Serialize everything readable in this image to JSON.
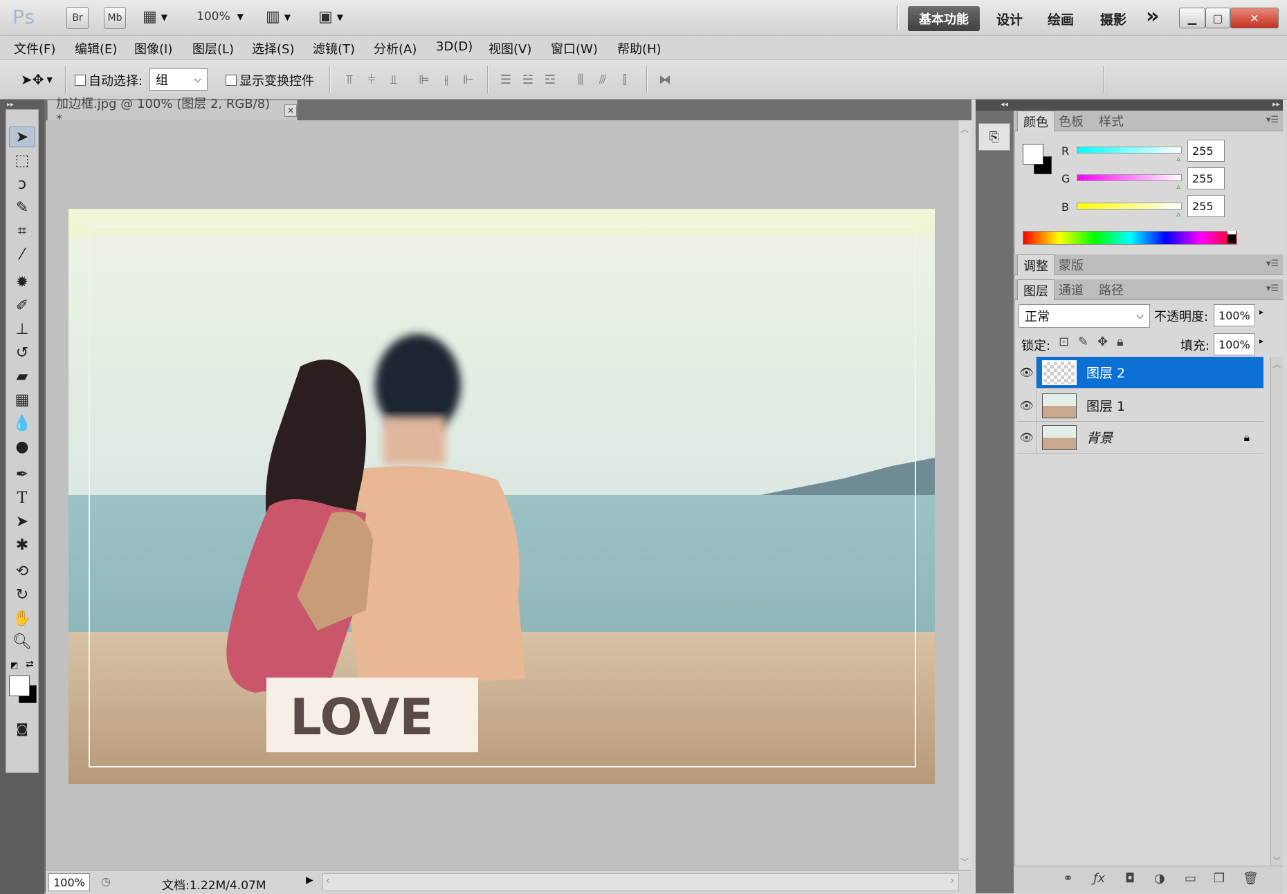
{
  "app": {
    "logo": "Ps",
    "bridge_badge": "Br",
    "minibridge_badge": "Mb",
    "zoom_level": "100%",
    "workspaces": [
      "基本功能",
      "设计",
      "绘画",
      "摄影"
    ],
    "more_workspaces": "»"
  },
  "menu": [
    "文件(F)",
    "编辑(E)",
    "图像(I)",
    "图层(L)",
    "选择(S)",
    "滤镜(T)",
    "分析(A)",
    "3D(D)",
    "视图(V)",
    "窗口(W)",
    "帮助(H)"
  ],
  "options": {
    "auto_select_label": "自动选择:",
    "auto_select_value": "组",
    "show_transform_label": "显示变换控件"
  },
  "document": {
    "tab_title": "加边框.jpg @ 100% (图层 2, RGB/8) *",
    "status_zoom": "100%",
    "status_doc": "文档:1.22M/4.07M",
    "image_text": "LOVE"
  },
  "color_panel": {
    "tabs": [
      "颜色",
      "色板",
      "样式"
    ],
    "r_label": "R",
    "g_label": "G",
    "b_label": "B",
    "r": "255",
    "g": "255",
    "b": "255"
  },
  "adjust_panel": {
    "tabs": [
      "调整",
      "蒙版"
    ]
  },
  "layers_panel": {
    "tabs": [
      "图层",
      "通道",
      "路径"
    ],
    "blend_mode": "正常",
    "opacity_label": "不透明度:",
    "opacity": "100%",
    "lock_label": "锁定:",
    "fill_label": "填充:",
    "fill": "100%",
    "layers": [
      {
        "name": "图层 2",
        "selected": true
      },
      {
        "name": "图层 1",
        "selected": false
      },
      {
        "name": "背景",
        "selected": false,
        "locked": true
      }
    ]
  },
  "colors": {
    "selected_layer": "#0b6fd6",
    "panel_bg": "#d8d8d8"
  }
}
